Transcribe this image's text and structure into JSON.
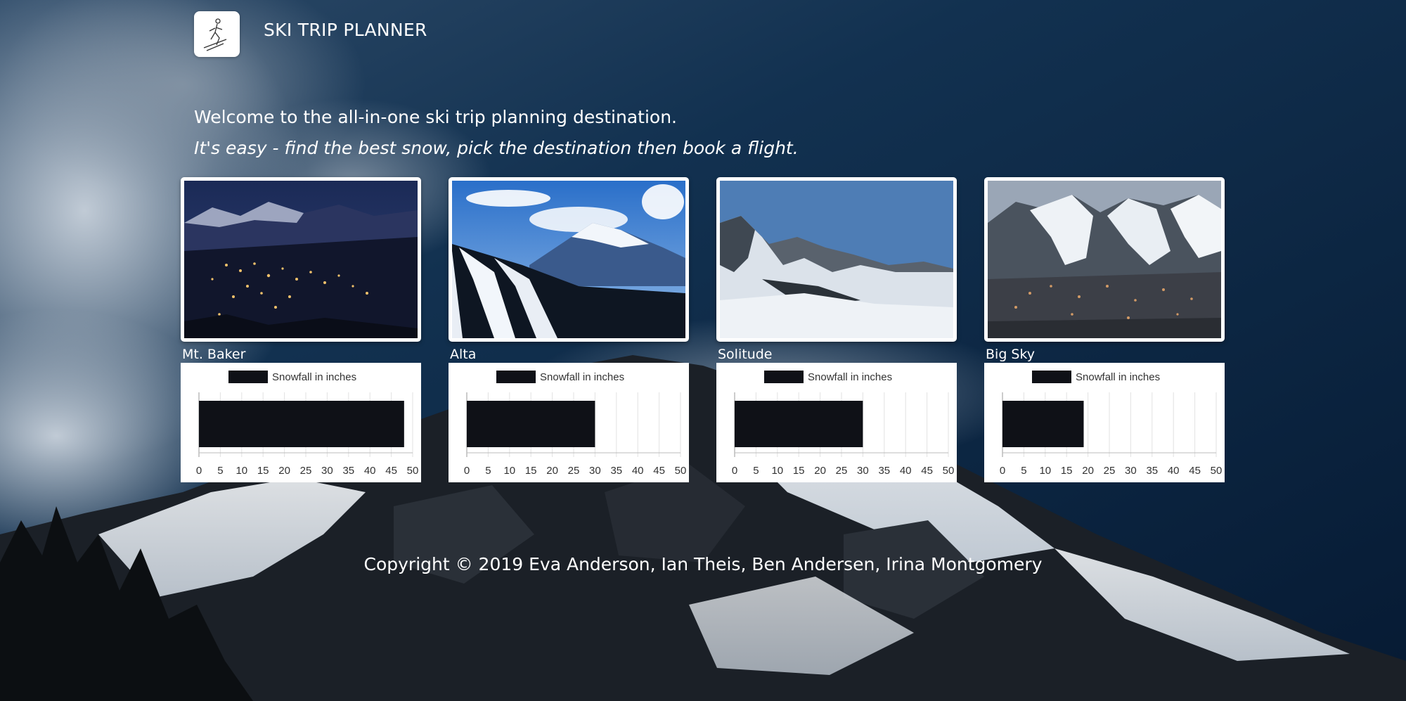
{
  "app": {
    "title": "SKI TRIP PLANNER",
    "logo_icon": "skier-icon"
  },
  "intro": {
    "welcome": "Welcome to the all-in-one ski trip planning destination.",
    "tagline": "It's easy - find the best snow, pick the destination then book a flight."
  },
  "resorts": [
    {
      "name": "Mt. Baker",
      "photo": "night-town-mountain-photo"
    },
    {
      "name": "Alta",
      "photo": "ski-slope-mountain-photo"
    },
    {
      "name": "Solitude",
      "photo": "snowy-peaks-photo"
    },
    {
      "name": "Big Sky",
      "photo": "mountain-village-photo"
    }
  ],
  "chart_data": [
    {
      "type": "bar",
      "orientation": "horizontal",
      "legend": "Snowfall in inches",
      "legend_position": "top",
      "values": [
        48
      ],
      "xlim": [
        0,
        50
      ],
      "ticks": [
        0,
        5,
        10,
        15,
        20,
        25,
        30,
        35,
        40,
        45,
        50
      ],
      "color": "#0f1117",
      "grid": true
    },
    {
      "type": "bar",
      "orientation": "horizontal",
      "legend": "Snowfall in inches",
      "legend_position": "top",
      "values": [
        30
      ],
      "xlim": [
        0,
        50
      ],
      "ticks": [
        0,
        5,
        10,
        15,
        20,
        25,
        30,
        35,
        40,
        45,
        50
      ],
      "color": "#0f1117",
      "grid": true
    },
    {
      "type": "bar",
      "orientation": "horizontal",
      "legend": "Snowfall in inches",
      "legend_position": "top",
      "values": [
        30
      ],
      "xlim": [
        0,
        50
      ],
      "ticks": [
        0,
        5,
        10,
        15,
        20,
        25,
        30,
        35,
        40,
        45,
        50
      ],
      "color": "#0f1117",
      "grid": true
    },
    {
      "type": "bar",
      "orientation": "horizontal",
      "legend": "Snowfall in inches",
      "legend_position": "top",
      "values": [
        19
      ],
      "xlim": [
        0,
        50
      ],
      "ticks": [
        0,
        5,
        10,
        15,
        20,
        25,
        30,
        35,
        40,
        45,
        50
      ],
      "color": "#0f1117",
      "grid": true
    }
  ],
  "footer": {
    "copyright": "Copyright © 2019 Eva Anderson, Ian Theis, Ben Andersen, Irina Montgomery"
  },
  "colors": {
    "sky_dark": "#0b2746",
    "sky_mid": "#153a5e",
    "snow": "#e8edf2",
    "rock": "#1c2128",
    "bar": "#0f1117"
  }
}
